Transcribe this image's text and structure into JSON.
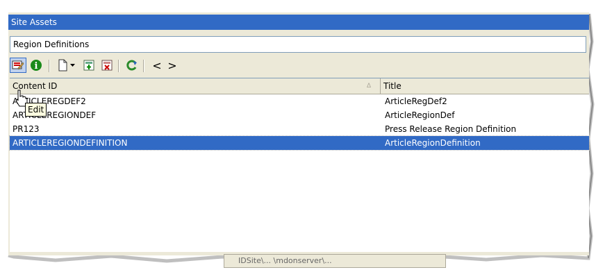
{
  "panel": {
    "title": "Site Assets"
  },
  "asset_type": {
    "selected": "Region Definitions"
  },
  "toolbar": {
    "buttons": [
      {
        "icon": "edit-icon",
        "tooltip": "Edit"
      },
      {
        "icon": "info-icon"
      },
      {
        "icon": "new-document-icon"
      },
      {
        "icon": "dropdown-arrow-icon"
      },
      {
        "icon": "add-to-workflow-icon"
      },
      {
        "icon": "remove-from-workflow-icon"
      },
      {
        "icon": "refresh-icon"
      },
      {
        "icon": "back-icon",
        "glyph": "<"
      },
      {
        "icon": "forward-icon",
        "glyph": ">"
      }
    ]
  },
  "table": {
    "columns": [
      "Content ID",
      "Title"
    ],
    "sort_indicator": "∆",
    "rows": [
      {
        "id": "ARTICLEREGDEF2",
        "title": "ArticleRegDef2"
      },
      {
        "id": "ARTICLEREGIONDEF",
        "title": "ArticleRegionDef"
      },
      {
        "id": "PR123",
        "title": "Press Release Region Definition"
      },
      {
        "id": "ARTICLEREGIONDEFINITION",
        "title": "ArticleRegionDefinition",
        "selected": true
      }
    ]
  },
  "tooltip": {
    "text": "Edit"
  },
  "statusbar": {
    "text": "IDSite\\...  \\mdonserver\\..."
  },
  "colors": {
    "title_bar": "#316ac5",
    "selection": "#316ac5",
    "chrome": "#ece9d8"
  }
}
